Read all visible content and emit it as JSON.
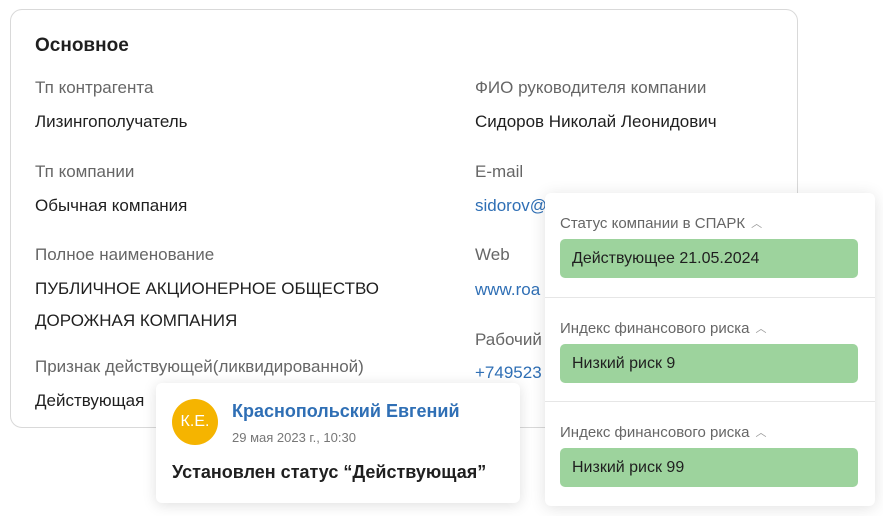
{
  "main": {
    "title": "Основное",
    "fields": {
      "counterparty_type": {
        "label": "Тп контрагента",
        "value": "Лизингополучатель"
      },
      "director": {
        "label": "ФИО руководителя компании",
        "value": "Сидоров Николай Леонидович"
      },
      "company_type": {
        "label": "Тп компании",
        "value": "Обычная компания"
      },
      "email": {
        "label": "E-mail",
        "value": "sidorov@"
      },
      "full_name": {
        "label": "Полное наименование",
        "value": "ПУБЛИЧНОЕ АКЦИОНЕРНОЕ ОБЩЕСТВО ДОРОЖНАЯ КОМПАНИЯ"
      },
      "web": {
        "label": "Web",
        "value": "www.roa"
      },
      "phone": {
        "label": "Рабочий",
        "value": "+749523"
      },
      "active_flag": {
        "label": "Признак действующей(ликвидированной)",
        "value": "Действующая"
      }
    }
  },
  "comment": {
    "avatar_initials": "К.Е.",
    "avatar_color": "#f5b400",
    "author": "Краснопольский Евгений",
    "timestamp": "29 мая 2023 г., 10:30",
    "text": "Установлен статус “Действующая”"
  },
  "risk_panel": {
    "chip_color": "#9dd39d",
    "sections": [
      {
        "label": "Статус компании в СПАРК",
        "icon": "chevron-up-icon",
        "value": "Действующее 21.05.2024"
      },
      {
        "label": "Индекс финансового риска",
        "icon": "chevron-up-icon",
        "value": "Низкий риск 9"
      },
      {
        "label": "Индекс финансового риска",
        "icon": "chevron-up-icon",
        "value": "Низкий риск 99"
      }
    ]
  }
}
